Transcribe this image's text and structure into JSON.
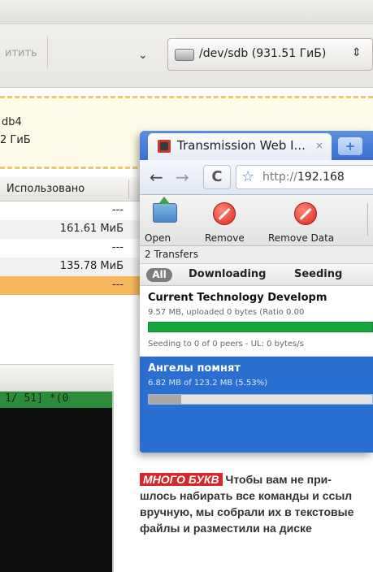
{
  "gparted": {
    "apply_label": "Применить",
    "apply_visible_fragment": "итить",
    "chevron": "⌄",
    "device_combo": "/dev/sdb  (931.51 ГиБ)",
    "combo_arrows": "⇕",
    "partition_name": "db4",
    "partition_size": "2 ГиБ",
    "column_header": "Использовано",
    "rows": [
      "---",
      "161.61 МиБ",
      "---",
      "135.78 МиБ",
      "---"
    ]
  },
  "terminal": {
    "status_line": "1/ 51] *(0"
  },
  "browser": {
    "tab_title": "Transmission Web I...",
    "tab_close": "×",
    "new_tab": "+",
    "url_scheme": "http://",
    "url_host": "192.168",
    "back": "←",
    "forward": "→",
    "reload": "C",
    "star": "☆"
  },
  "transmission": {
    "actions": [
      {
        "label": "Open",
        "icon": "folder-open-icon"
      },
      {
        "label": "Remove",
        "icon": "remove-icon"
      },
      {
        "label": "Remove Data",
        "icon": "remove-data-icon"
      }
    ],
    "transfer_count": "2 Transfers",
    "filters": {
      "all": "All",
      "downloading": "Downloading",
      "seeding": "Seeding"
    },
    "torrents": [
      {
        "name": "Current Technology Developm",
        "progress_text": "9.57 MB, uploaded 0 bytes (Ratio 0.00",
        "peers_text": "Seeding to 0 of 0 peers - UL: 0 bytes/s",
        "percent": 100,
        "selected": false
      },
      {
        "name": "Ангелы помнят",
        "progress_text": "6.82 MB of 123.2 MB (5.53%)",
        "peers_text": "",
        "percent": 5.53,
        "selected": true
      }
    ]
  },
  "caption": {
    "tag": "МНОГО БУКВ",
    "line1": "Чтобы вам не при-",
    "line2": "шлось набирать все команды и ссыл",
    "line3": "вручную, мы собрали их в текстовые",
    "line4": "файлы и разместили на диске"
  },
  "colors": {
    "selected_row": "#f7b85d",
    "terminal_status": "#2e8b3a",
    "progress_complete": "#18a63e",
    "selected_torrent": "#2a6fd0",
    "caption_tag": "#d7262c"
  }
}
